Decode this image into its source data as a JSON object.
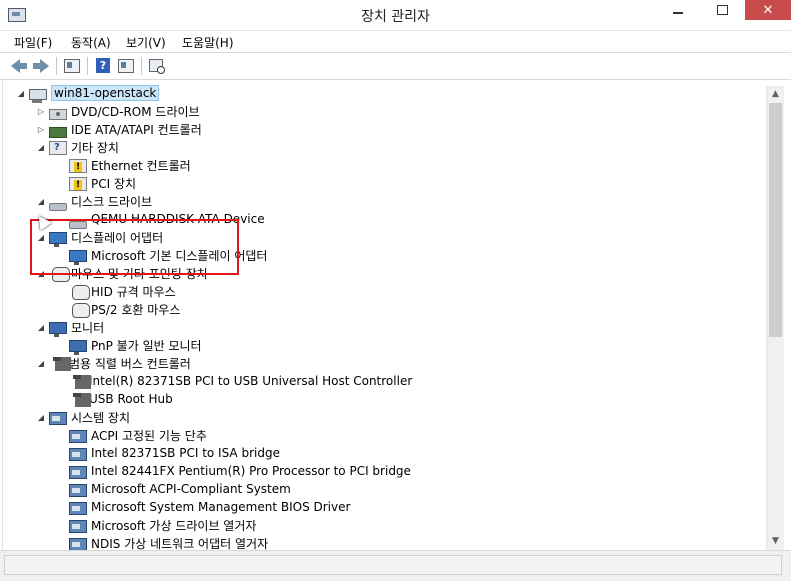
{
  "window": {
    "title": "장치 관리자",
    "controls": [
      "min",
      "max",
      "close"
    ]
  },
  "menu": [
    "파일(F)",
    "동작(A)",
    "보기(V)",
    "도움말(H)"
  ],
  "toolbar": [
    {
      "name": "back-icon"
    },
    {
      "name": "forward-icon"
    },
    {
      "name": "show-hide-console-tree-icon"
    },
    {
      "name": "help-icon"
    },
    {
      "name": "properties-icon"
    },
    {
      "name": "scan-hardware-icon"
    }
  ],
  "tree": {
    "root": {
      "label": "win81-openstack"
    },
    "categories": [
      {
        "label": "DVD/CD-ROM 드라이브",
        "expanded": false,
        "icon": "dvd-drive-icon",
        "children": []
      },
      {
        "label": "IDE ATA/ATAPI 컨트롤러",
        "expanded": false,
        "icon": "ide-controller-icon",
        "children": []
      },
      {
        "label": "기타 장치",
        "expanded": true,
        "icon": "other-devices-icon",
        "children": [
          {
            "label": "Ethernet 컨트롤러",
            "icon": "warning-device-icon"
          },
          {
            "label": "PCI 장치",
            "icon": "warning-device-icon"
          }
        ]
      },
      {
        "label": "디스크 드라이브",
        "expanded": true,
        "icon": "disk-drive-icon",
        "children": [
          {
            "label": "QEMU HARDDISK ATA Device",
            "icon": "hard-disk-icon"
          }
        ]
      },
      {
        "label": "디스플레이 어댑터",
        "expanded": true,
        "icon": "display-adapter-icon",
        "children": [
          {
            "label": "Microsoft 기본 디스플레이 어댑터",
            "icon": "display-adapter-icon"
          }
        ]
      },
      {
        "label": "마우스 및 기타 포인팅 장치",
        "expanded": true,
        "icon": "mouse-icon",
        "children": [
          {
            "label": "HID 규격 마우스",
            "icon": "mouse-icon"
          },
          {
            "label": "PS/2 호환 마우스",
            "icon": "mouse-icon"
          }
        ]
      },
      {
        "label": "모니터",
        "expanded": true,
        "icon": "monitor-icon",
        "children": [
          {
            "label": "PnP 불가 일반 모니터",
            "icon": "monitor-icon"
          }
        ]
      },
      {
        "label": "범용 직렬 버스 컨트롤러",
        "expanded": true,
        "icon": "usb-icon",
        "children": [
          {
            "label": "Intel(R) 82371SB PCI to USB Universal Host Controller",
            "icon": "usb-icon"
          },
          {
            "label": "USB Root Hub",
            "icon": "usb-icon"
          }
        ]
      },
      {
        "label": "시스템 장치",
        "expanded": true,
        "icon": "system-device-icon",
        "children": [
          {
            "label": "ACPI 고정된 기능 단추",
            "icon": "system-device-icon"
          },
          {
            "label": "Intel 82371SB PCI to ISA bridge",
            "icon": "system-device-icon"
          },
          {
            "label": "Intel 82441FX Pentium(R) Pro Processor to PCI bridge",
            "icon": "system-device-icon"
          },
          {
            "label": "Microsoft ACPI-Compliant System",
            "icon": "system-device-icon"
          },
          {
            "label": "Microsoft System Management BIOS Driver",
            "icon": "system-device-icon"
          },
          {
            "label": "Microsoft 가상 드라이브 열거자",
            "icon": "system-device-icon"
          },
          {
            "label": "NDIS 가상 네트워크 어댑터 열거자",
            "icon": "system-device-icon"
          }
        ]
      }
    ]
  },
  "annotation": {
    "color": "#e0161c"
  }
}
